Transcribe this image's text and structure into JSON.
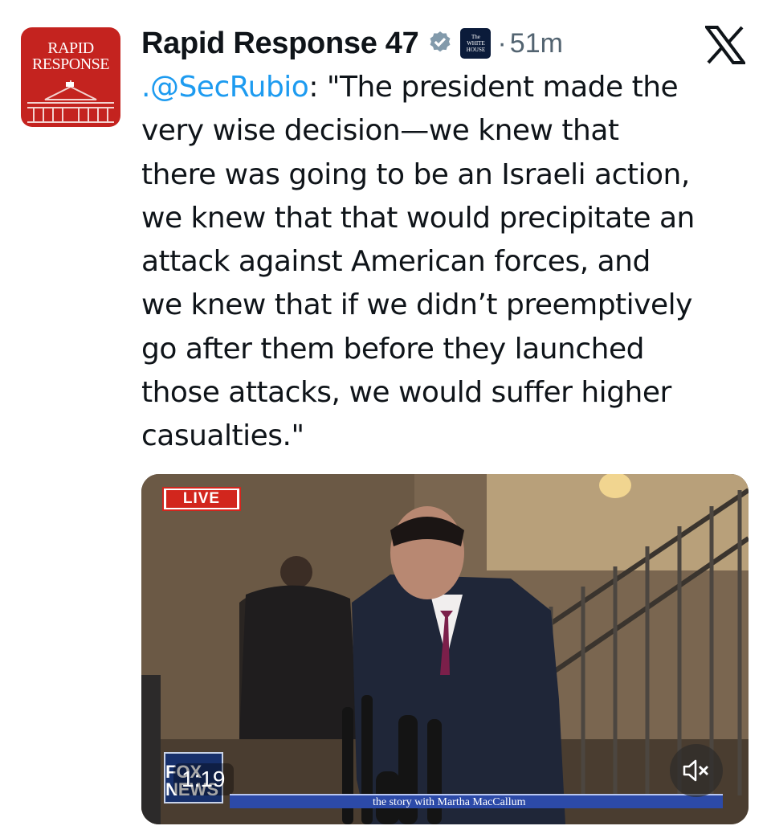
{
  "account": {
    "avatar_text_line1": "RAPID",
    "avatar_text_line2": "RESPONSE",
    "display_name": "Rapid Response 47",
    "affiliation_badge_text": "The WHITE HOUSE",
    "separator": "·",
    "timestamp": "51m",
    "verified": true
  },
  "tweet": {
    "mention": ".@SecRubio",
    "body": ": \"The president made the\nvery wise decision—we knew that\nthere was going to be an Israeli action,\nwe knew that that would precipitate an\nattack against American forces, and\nwe knew that if we didn’t preemptively\ngo after them before they launched\nthose attacks, we would suffer higher\ncasualties.\""
  },
  "media": {
    "live_label": "LIVE",
    "network_logo_text": "FOX NEWS",
    "duration": "1:19",
    "lower_third": "the story  with Martha MacCallum",
    "mute_icon": "speaker-muted-icon"
  },
  "colors": {
    "brand_red": "#c4231f",
    "link_blue": "#1d9bf0",
    "verified_gray": "#829aab",
    "muted_text": "#536471"
  },
  "icons": [
    "x-logo-icon",
    "verified-badge-icon",
    "speaker-muted-icon"
  ]
}
